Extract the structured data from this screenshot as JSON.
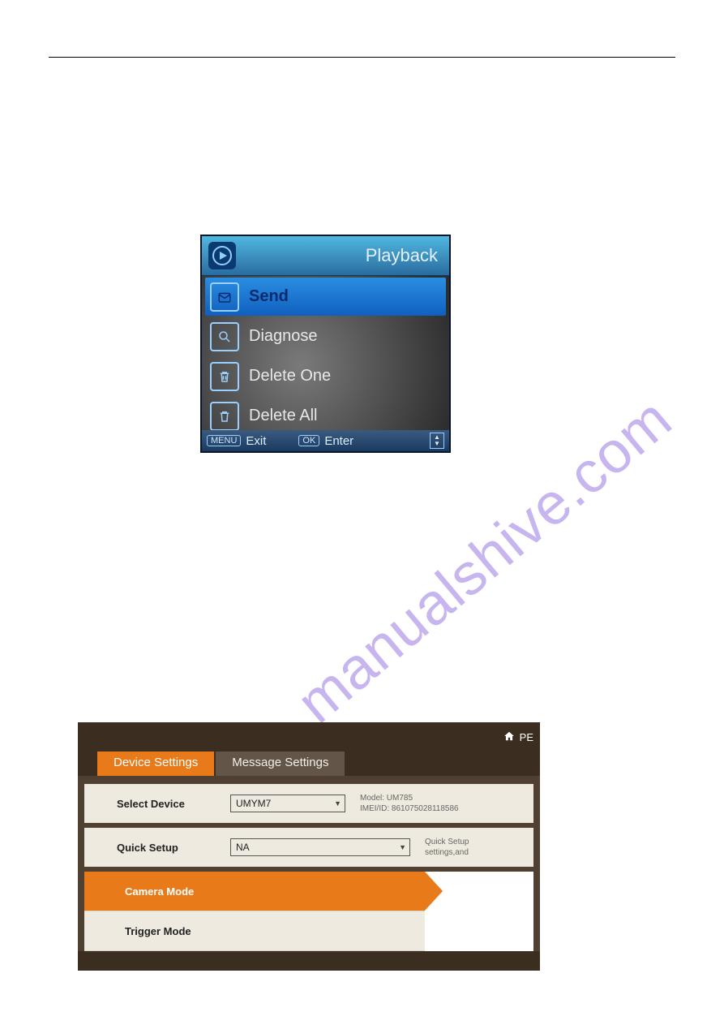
{
  "watermark": "manualshive.com",
  "playback": {
    "title": "Playback",
    "items": [
      {
        "icon": "send-icon",
        "label": "Send",
        "selected": true
      },
      {
        "icon": "diagnose-icon",
        "label": "Diagnose",
        "selected": false
      },
      {
        "icon": "delete-one-icon",
        "label": "Delete One",
        "selected": false
      },
      {
        "icon": "delete-all-icon",
        "label": "Delete All",
        "selected": false
      }
    ],
    "footer": {
      "menu_btn": "MENU",
      "exit": "Exit",
      "ok_btn": "OK",
      "enter": "Enter"
    }
  },
  "settings": {
    "topnav": "PE",
    "tabs": [
      {
        "label": "Device Settings",
        "active": true
      },
      {
        "label": "Message Settings",
        "active": false
      }
    ],
    "select_device": {
      "label": "Select Device",
      "value": "UMYM7",
      "model_label": "Model:",
      "model": "UM785",
      "imei_label": "IMEI/ID:",
      "imei": "861075028118586"
    },
    "quick_setup": {
      "label": "Quick Setup",
      "value": "NA",
      "hint1": "Quick Setup",
      "hint2": "settings,and"
    },
    "accordion": [
      {
        "label": "Camera Mode",
        "active": true
      },
      {
        "label": "Trigger Mode",
        "active": false
      }
    ]
  }
}
